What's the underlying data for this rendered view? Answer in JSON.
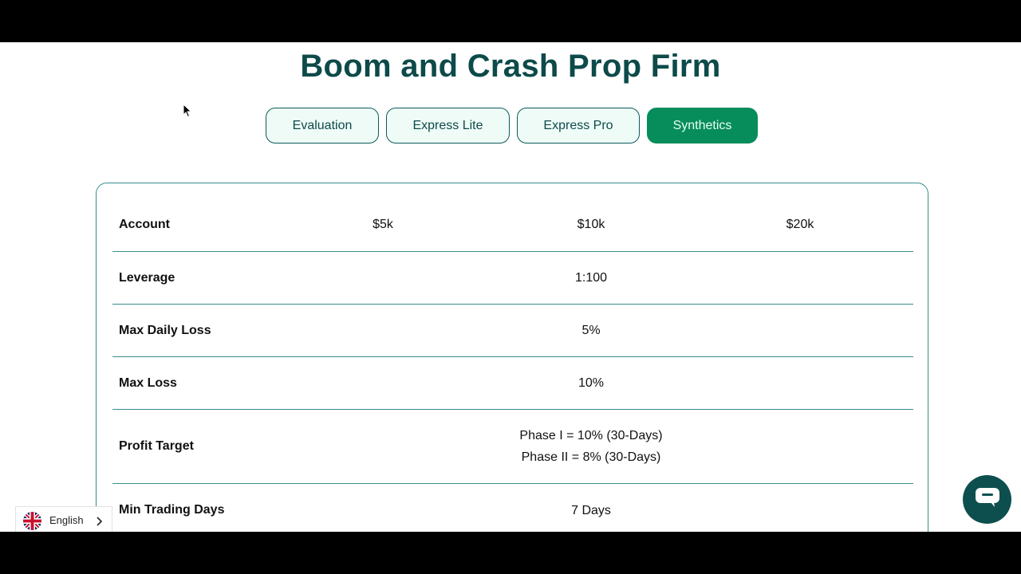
{
  "page": {
    "title": "Boom and Crash Prop Firm"
  },
  "tabs": [
    {
      "label": "Evaluation",
      "active": false
    },
    {
      "label": "Express Lite",
      "active": false
    },
    {
      "label": "Express Pro",
      "active": false
    },
    {
      "label": "Synthetics",
      "active": true
    }
  ],
  "table": {
    "account": {
      "label": "Account",
      "values": [
        "$5k",
        "$10k",
        "$20k"
      ]
    },
    "leverage": {
      "label": "Leverage",
      "value": "1:100"
    },
    "max_daily_loss": {
      "label": "Max Daily Loss",
      "value": "5%"
    },
    "max_loss": {
      "label": "Max Loss",
      "value": "10%"
    },
    "profit_target": {
      "label": "Profit Target",
      "lines": [
        "Phase I = 10% (30-Days)",
        "Phase II = 8% (30-Days)"
      ]
    },
    "min_trading_days": {
      "label": "Min Trading Days",
      "value": "7 Days"
    }
  },
  "language": {
    "label": "English",
    "icon": "uk-flag-icon"
  },
  "chat": {
    "icon": "chat-bubble-icon"
  },
  "colors": {
    "title": "#0d4a4a",
    "tab_active_bg": "#078d5c",
    "tab_bg": "#eefbf6",
    "border": "#3a8c8c",
    "chat_bg": "#0d4f4f"
  }
}
